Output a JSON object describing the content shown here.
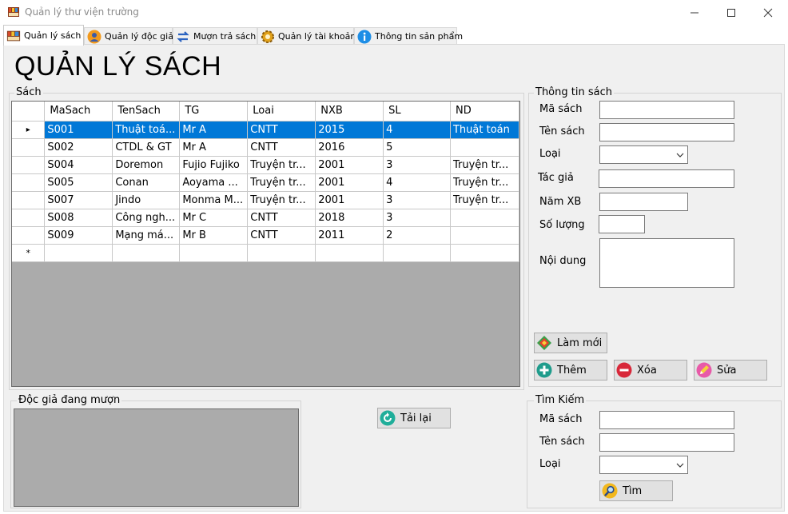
{
  "window": {
    "title": "Quản lý thư viện trường"
  },
  "tabs": [
    {
      "label": "Quản lý sách",
      "icon": "books-icon",
      "active": true
    },
    {
      "label": "Quản lý độc giả",
      "icon": "user-icon"
    },
    {
      "label": "Mượn trả sách",
      "icon": "swap-arrows-icon"
    },
    {
      "label": "Quản lý tài khoản",
      "icon": "gear-icon"
    },
    {
      "label": "Thông tin sản phẩm",
      "icon": "info-icon"
    }
  ],
  "page": {
    "title": "QUẢN LÝ SÁCH"
  },
  "books_group": {
    "label": "Sách",
    "columns": [
      "MaSach",
      "TenSach",
      "TG",
      "Loai",
      "NXB",
      "SL",
      "ND"
    ],
    "rows": [
      [
        "S001",
        "Thuật toá...",
        "Mr A",
        "CNTT",
        "2015",
        "4",
        "Thuật toán"
      ],
      [
        "S002",
        "CTDL & GT",
        "Mr A",
        "CNTT",
        "2016",
        "5",
        ""
      ],
      [
        "S004",
        "Doremon",
        "Fujio Fujiko",
        "Truyện tr...",
        "2001",
        "3",
        "Truyện tr..."
      ],
      [
        "S005",
        "Conan",
        "Aoyama ...",
        "Truyện tr...",
        "2001",
        "4",
        "Truyện tr..."
      ],
      [
        "S007",
        "Jindo",
        "Monma M...",
        "Truyện tr...",
        "2001",
        "3",
        "Truyện tr..."
      ],
      [
        "S008",
        "Công ngh...",
        "Mr C",
        "CNTT",
        "2018",
        "3",
        ""
      ],
      [
        "S009",
        "Mạng má...",
        "Mr B",
        "CNTT",
        "2011",
        "2",
        ""
      ]
    ],
    "selected_row": 0,
    "current_marker": "▸",
    "new_row_marker": "*"
  },
  "info_group": {
    "label": "Thông tin sách",
    "fields": {
      "ma_sach": "Mã sách",
      "ten_sach": "Tên sách",
      "loai": "Loại",
      "tac_gia": "Tác giả",
      "nam_xb": "Năm XB",
      "so_luong": "Số lượng",
      "noi_dung": "Nội dung"
    },
    "buttons": {
      "lam_moi": "Làm mới",
      "them": "Thêm",
      "xoa": "Xóa",
      "sua": "Sửa"
    }
  },
  "borrowers_group": {
    "label": "Độc  giả đang mượn"
  },
  "reload_button": {
    "label": "Tải lại"
  },
  "search_group": {
    "label": "Tìm Kiếm",
    "fields": {
      "ma_sach": "Mã sách",
      "ten_sach": "Tên sách",
      "loai": "Loại"
    },
    "button": "Tìm"
  }
}
